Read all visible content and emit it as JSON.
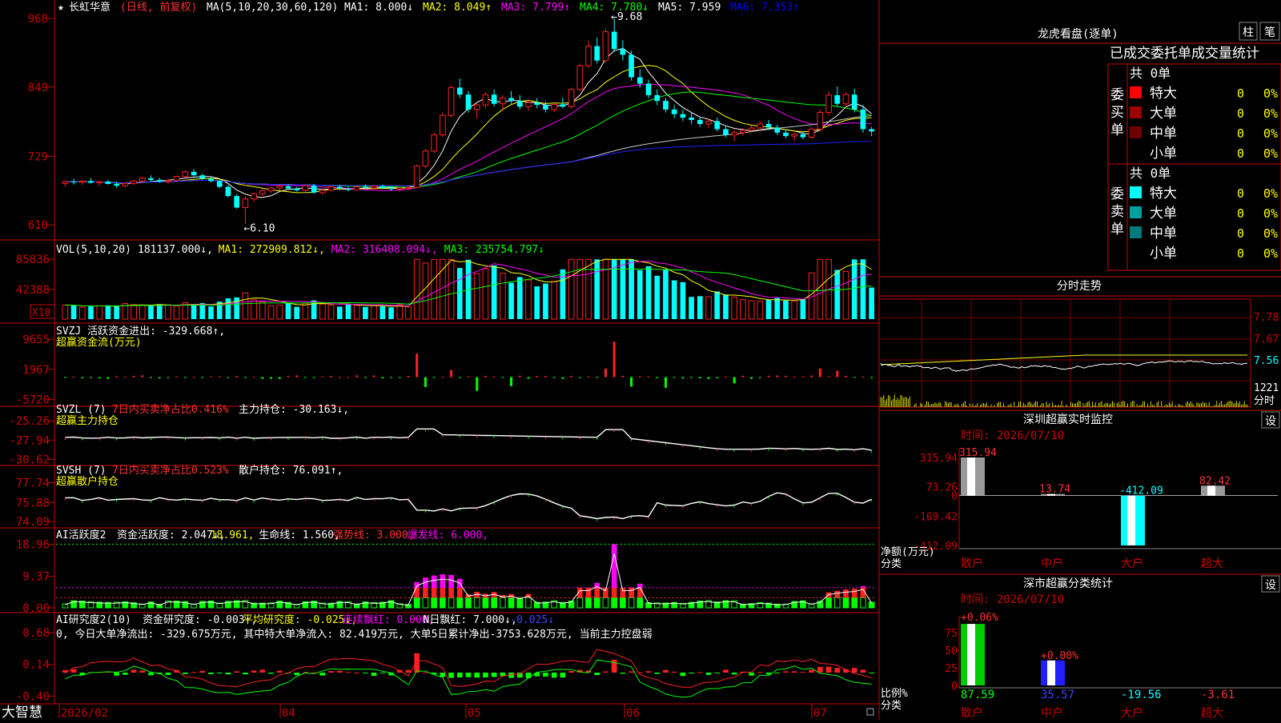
{
  "header": {
    "star": "★",
    "stock_name": "长虹华意",
    "period_label": "(日线, 前复权)",
    "ma_header": "MA(5,10,20,30,60,120)",
    "ma_items": [
      {
        "label": "MA1: 8.000↓",
        "color": "#ffffff"
      },
      {
        "label": "MA2: 8.049↑",
        "color": "#ffff00"
      },
      {
        "label": "MA3: 7.799↑",
        "color": "#ff00ff"
      },
      {
        "label": "MA4: 7.780↓",
        "color": "#00ff00"
      },
      {
        "label": "MA5: 7.959",
        "color": "#ffffff"
      },
      {
        "label": "MA6: 7.353↑",
        "color": "#0000ff"
      }
    ]
  },
  "colors": {
    "up": "#ff2020",
    "down": "#00ffff",
    "axis": "#cc0000",
    "grid": "#7a0000"
  },
  "price_panel": {
    "y_ticks": [
      "968",
      "849",
      "729",
      "610"
    ],
    "high_label": "9.68",
    "low_label": "6.10",
    "ylim": [
      5.95,
      9.75
    ]
  },
  "volume_panel": {
    "title": "VOL(5,10,20)",
    "items": [
      {
        "label": "181137.000↓,",
        "color": "#ffffff"
      },
      {
        "label": "MA1: 272909.812↓,",
        "color": "#ffff00"
      },
      {
        "label": "MA2: 316408.094↓,",
        "color": "#ff00ff"
      },
      {
        "label": "MA3: 235754.797↓",
        "color": "#00ff00"
      }
    ],
    "y_ticks": [
      "85836",
      "42388"
    ],
    "unit": "X10",
    "ymax": 95000
  },
  "svzj_panel": {
    "title": "SVZJ  活跃资金进出: -329.668↑,",
    "subtitle": "超赢资金流(万元)",
    "y_ticks": [
      "9655",
      "1967",
      "-5720"
    ],
    "ylim": [
      -6200,
      10500
    ]
  },
  "svzl_panel": {
    "title_a": "SVZL (7) ",
    "title_b": "7日内买卖净占比0.416%",
    "title_c": " 主力持仓: -30.163↓,",
    "subtitle": "超赢主力持仓",
    "y_ticks": [
      "-25.26",
      "-27.94",
      "-30.62"
    ],
    "ylim": [
      -31.0,
      -24.6
    ]
  },
  "svsh_panel": {
    "title_a": "SVSH (7) ",
    "title_b": "7日内买卖净占比0.523%",
    "title_c": " 散户持仓: 76.091↑,",
    "subtitle": "超赢散户持仓",
    "y_ticks": [
      "77.74",
      "75.88",
      "74.09"
    ],
    "ylim": [
      73.8,
      78.3
    ]
  },
  "ai_active_panel": {
    "title": "AI活跃度2",
    "items": [
      {
        "label": "资金活跃度: 2.047↓,",
        "color": "#ffffff"
      },
      {
        "label": "18.961,",
        "color": "#ffff00"
      },
      {
        "label": "生命线: 1.560,",
        "color": "#ffffff"
      },
      {
        "label": "强势线: 3.000,",
        "color": "#ff3030"
      },
      {
        "label": "爆发线: 6.000,",
        "color": "#ff00ff"
      }
    ],
    "y_ticks": [
      "18.96",
      "9.37",
      "0.00"
    ],
    "ymax": 20
  },
  "ai_research_panel": {
    "title": "AI研究度2(10)",
    "items": [
      {
        "label": "资金研究度: -0.003↑,",
        "color": "#ffffff"
      },
      {
        "label": "平均研究度: -0.025↓,",
        "color": "#ffff00"
      },
      {
        "label": "连续飘红: 0.000,",
        "color": "#ff00ff"
      },
      {
        "label": "N日飘红: 7.000↓,",
        "color": "#ffffff"
      },
      {
        "label": "-0.025↓",
        "color": "#4040ff"
      }
    ],
    "note": "0, 今日大单净流出: -329.675万元, 其中特大单净流入: 82.419万元, 大单5日累计净出-3753.628万元, 当前主力控盘弱",
    "y_ticks": [
      "0.68",
      "0.14",
      "-0.40"
    ],
    "ylim": [
      -0.45,
      0.75
    ]
  },
  "x_axis": {
    "brand": "大智慧",
    "labels": [
      "2026/02",
      "04",
      "05",
      "06",
      "07"
    ]
  },
  "longhu": {
    "title": "龙虎看盘(逐单)",
    "btn1": "柱",
    "btn2": "笔",
    "table_header": "已成交委托单成交量统计",
    "buy_side": "委买单",
    "sell_side": "委卖单",
    "buy_total": "共 0单",
    "sell_total": "共 0单",
    "buy_rows": [
      {
        "color": "#ff0000",
        "label": "特大",
        "count": "0",
        "pct": "0%"
      },
      {
        "color": "#a00000",
        "label": "大单",
        "count": "0",
        "pct": "0%"
      },
      {
        "color": "#700000",
        "label": "中单",
        "count": "0",
        "pct": "0%"
      },
      {
        "color": "",
        "label": "小单",
        "count": "0",
        "pct": "0%"
      }
    ],
    "sell_rows": [
      {
        "color": "#00ffff",
        "label": "特大",
        "count": "0",
        "pct": "0%"
      },
      {
        "color": "#00a0a0",
        "label": "大单",
        "count": "0",
        "pct": "0%"
      },
      {
        "color": "#007a7a",
        "label": "中单",
        "count": "0",
        "pct": "0%"
      },
      {
        "color": "",
        "label": "小单",
        "count": "0",
        "pct": "0%"
      }
    ]
  },
  "minute_chart": {
    "title": "分时走势",
    "y_ticks": [
      "7.78",
      "7.67",
      "7.56",
      "1221",
      "分时"
    ]
  },
  "sz_monitor": {
    "title": "深圳超赢实时监控",
    "set_label": "设",
    "time_label": "时间: 2026/07/10",
    "y_ticks": [
      "315.94",
      "73.26",
      "0",
      "-169.42",
      "-412.09"
    ],
    "unit_label": "净额(万元)",
    "cat_label": "分类",
    "categories": [
      "散户",
      "中户",
      "大户",
      "超大"
    ],
    "values": [
      315.94,
      13.74,
      -412.09,
      82.42
    ],
    "value_labels": [
      "315.94",
      "13.74",
      "-412.09",
      "82.42"
    ],
    "ylim": [
      -412.09,
      315.94
    ]
  },
  "sz_category": {
    "title": "深市超赢分类统计",
    "set_label": "设",
    "time_label": "时间: 2026/07/10",
    "y_ticks": [
      "75",
      "50",
      "25",
      "0"
    ],
    "unit_label": "比例%",
    "cat_label": "分类",
    "categories": [
      "散户",
      "中户",
      "大户",
      "超大"
    ],
    "change_labels": [
      "+0.06%",
      "+0.00%",
      "",
      ""
    ],
    "values": [
      87.59,
      35.57,
      -19.56,
      -3.61
    ],
    "value_labels": [
      "87.59",
      "35.57",
      "-19.56",
      "-3.61"
    ],
    "value_colors": [
      "#00ff00",
      "#4040ff",
      "#00ffff",
      "#ff3030"
    ]
  },
  "chart_data": {
    "type": "candlestick",
    "title": "长虹华意 (日线, 前复权)",
    "note": "Daily K-line, prices in CNY (estimated from axis)",
    "x_range": [
      "2026/02",
      "2026/07/10"
    ],
    "candles": [
      [
        6.82,
        6.87,
        6.77,
        6.85
      ],
      [
        6.85,
        6.9,
        6.8,
        6.84
      ],
      [
        6.84,
        6.88,
        6.79,
        6.86
      ],
      [
        6.86,
        6.91,
        6.82,
        6.83
      ],
      [
        6.83,
        6.87,
        6.78,
        6.85
      ],
      [
        6.85,
        6.88,
        6.8,
        6.81
      ],
      [
        6.81,
        6.85,
        6.74,
        6.78
      ],
      [
        6.78,
        6.84,
        6.75,
        6.82
      ],
      [
        6.82,
        6.88,
        6.79,
        6.86
      ],
      [
        6.86,
        6.93,
        6.84,
        6.91
      ],
      [
        6.91,
        6.96,
        6.86,
        6.88
      ],
      [
        6.88,
        6.92,
        6.83,
        6.85
      ],
      [
        6.85,
        6.9,
        6.81,
        6.87
      ],
      [
        6.87,
        6.95,
        6.86,
        6.94
      ],
      [
        6.94,
        7.05,
        6.92,
        7.02
      ],
      [
        7.02,
        7.07,
        6.94,
        6.96
      ],
      [
        6.96,
        6.99,
        6.88,
        6.9
      ],
      [
        6.9,
        6.93,
        6.84,
        6.86
      ],
      [
        6.86,
        6.88,
        6.74,
        6.76
      ],
      [
        6.76,
        6.79,
        6.58,
        6.6
      ],
      [
        6.6,
        6.63,
        6.38,
        6.4
      ],
      [
        6.4,
        6.6,
        6.12,
        6.55
      ],
      [
        6.55,
        6.66,
        6.5,
        6.64
      ],
      [
        6.64,
        6.72,
        6.6,
        6.69
      ],
      [
        6.69,
        6.76,
        6.65,
        6.74
      ],
      [
        6.74,
        6.8,
        6.7,
        6.77
      ],
      [
        6.77,
        6.8,
        6.71,
        6.73
      ],
      [
        6.73,
        6.76,
        6.68,
        6.7
      ],
      [
        6.7,
        6.8,
        6.68,
        6.78
      ],
      [
        6.78,
        6.81,
        6.64,
        6.66
      ],
      [
        6.66,
        6.72,
        6.62,
        6.7
      ],
      [
        6.7,
        6.78,
        6.68,
        6.76
      ],
      [
        6.76,
        6.79,
        6.7,
        6.73
      ],
      [
        6.73,
        6.76,
        6.68,
        6.71
      ],
      [
        6.71,
        6.78,
        6.7,
        6.76
      ],
      [
        6.76,
        6.8,
        6.72,
        6.74
      ],
      [
        6.74,
        6.79,
        6.71,
        6.77
      ],
      [
        6.77,
        6.8,
        6.72,
        6.74
      ],
      [
        6.74,
        6.77,
        6.69,
        6.72
      ],
      [
        6.72,
        6.76,
        6.68,
        6.74
      ],
      [
        6.74,
        6.78,
        6.71,
        6.75
      ],
      [
        6.75,
        7.15,
        6.74,
        7.12
      ],
      [
        7.12,
        7.42,
        7.08,
        7.38
      ],
      [
        7.38,
        7.7,
        7.34,
        7.66
      ],
      [
        7.66,
        8.05,
        7.62,
        8.0
      ],
      [
        8.0,
        8.52,
        7.96,
        8.48
      ],
      [
        8.48,
        8.64,
        8.3,
        8.36
      ],
      [
        8.36,
        8.42,
        8.05,
        8.1
      ],
      [
        8.1,
        8.22,
        7.95,
        8.18
      ],
      [
        8.18,
        8.4,
        8.12,
        8.36
      ],
      [
        8.36,
        8.45,
        8.15,
        8.2
      ],
      [
        8.2,
        8.35,
        8.1,
        8.3
      ],
      [
        8.3,
        8.42,
        8.2,
        8.25
      ],
      [
        8.25,
        8.35,
        8.1,
        8.15
      ],
      [
        8.15,
        8.28,
        8.08,
        8.22
      ],
      [
        8.22,
        8.3,
        8.12,
        8.18
      ],
      [
        8.18,
        8.24,
        8.05,
        8.1
      ],
      [
        8.1,
        8.22,
        8.06,
        8.19
      ],
      [
        8.19,
        8.3,
        8.12,
        8.15
      ],
      [
        8.15,
        8.48,
        8.12,
        8.45
      ],
      [
        8.45,
        8.9,
        8.42,
        8.86
      ],
      [
        8.86,
        9.3,
        8.82,
        9.2
      ],
      [
        9.2,
        9.35,
        8.9,
        8.95
      ],
      [
        8.95,
        9.5,
        8.92,
        9.45
      ],
      [
        9.45,
        9.68,
        9.1,
        9.15
      ],
      [
        9.15,
        9.3,
        8.95,
        9.05
      ],
      [
        9.05,
        9.12,
        8.6,
        8.66
      ],
      [
        8.66,
        8.8,
        8.48,
        8.55
      ],
      [
        8.55,
        8.62,
        8.3,
        8.35
      ],
      [
        8.35,
        8.45,
        8.18,
        8.25
      ],
      [
        8.25,
        8.3,
        8.05,
        8.1
      ],
      [
        8.1,
        8.18,
        7.95,
        8.02
      ],
      [
        8.02,
        8.1,
        7.9,
        7.96
      ],
      [
        7.96,
        8.05,
        7.85,
        7.92
      ],
      [
        7.92,
        7.98,
        7.8,
        7.85
      ],
      [
        7.85,
        7.95,
        7.78,
        7.9
      ],
      [
        7.9,
        7.96,
        7.72,
        7.76
      ],
      [
        7.76,
        7.82,
        7.62,
        7.66
      ],
      [
        7.66,
        7.75,
        7.55,
        7.7
      ],
      [
        7.7,
        7.78,
        7.64,
        7.74
      ],
      [
        7.74,
        7.82,
        7.7,
        7.78
      ],
      [
        7.78,
        7.9,
        7.74,
        7.85
      ],
      [
        7.85,
        7.92,
        7.75,
        7.79
      ],
      [
        7.79,
        7.84,
        7.66,
        7.7
      ],
      [
        7.7,
        7.76,
        7.6,
        7.64
      ],
      [
        7.64,
        7.7,
        7.56,
        7.67
      ],
      [
        7.67,
        7.72,
        7.58,
        7.62
      ],
      [
        7.62,
        7.8,
        7.6,
        7.76
      ],
      [
        7.76,
        8.1,
        7.72,
        8.05
      ],
      [
        8.05,
        8.42,
        8.0,
        8.35
      ],
      [
        8.35,
        8.5,
        8.15,
        8.2
      ],
      [
        8.2,
        8.4,
        8.14,
        8.36
      ],
      [
        8.36,
        8.46,
        8.05,
        8.1
      ],
      [
        8.1,
        8.18,
        7.7,
        7.76
      ],
      [
        7.76,
        7.8,
        7.64,
        7.72
      ]
    ]
  }
}
